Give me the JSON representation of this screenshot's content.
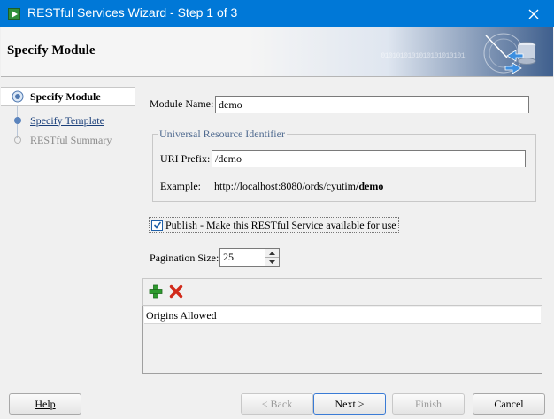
{
  "window": {
    "title": "RESTful Services Wizard - Step 1 of 3"
  },
  "header": {
    "title": "Specify Module",
    "binary_decoration": "0101010101010101010101"
  },
  "nav": {
    "items": [
      {
        "label": "Specify Module",
        "state": "active"
      },
      {
        "label": "Specify Template",
        "state": "link"
      },
      {
        "label": "RESTful Summary",
        "state": "disabled"
      }
    ]
  },
  "form": {
    "module_name_label": "Module Name:",
    "module_name_value": "demo",
    "uri_group_label": "Universal Resource Identifier",
    "uri_prefix_label": "URI Prefix:",
    "uri_prefix_value": "/demo",
    "example_label": "Example:",
    "example_base": "http://localhost:8080/ords/cyutim",
    "example_suffix": "/demo",
    "publish_checked": true,
    "publish_label": "Publish - Make this RESTful Service available for use",
    "pagination_label": "Pagination Size:",
    "pagination_value": "25"
  },
  "origins": {
    "column_header": "Origins Allowed",
    "rows": []
  },
  "buttons": {
    "help": "Help",
    "back": "< Back",
    "next": "Next >",
    "finish": "Finish",
    "cancel": "Cancel"
  },
  "colors": {
    "titlebar": "#0078d7",
    "link": "#1a3f7a",
    "add_icon": "#2e9a2e",
    "remove_icon": "#d12a1a"
  },
  "icons": {
    "close": "close-icon",
    "add": "add-icon",
    "remove": "remove-icon",
    "app": "app-icon"
  }
}
